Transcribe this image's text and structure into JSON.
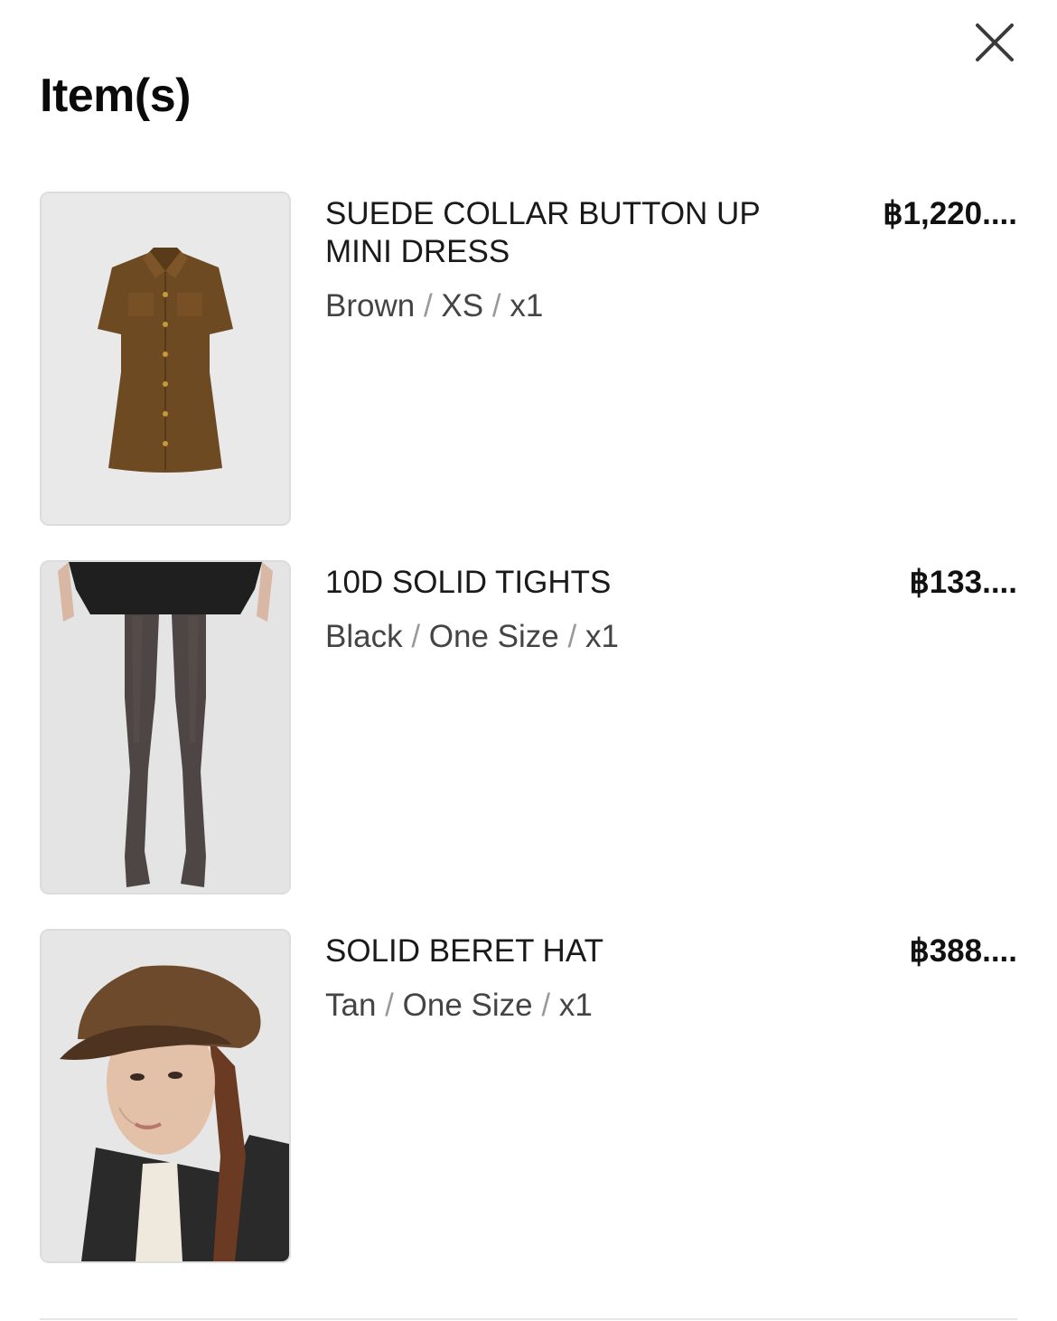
{
  "header": {
    "title": "Item(s)",
    "close_icon": "close-icon"
  },
  "items": [
    {
      "name": "SUEDE COLLAR BUTTON UP MINI DRESS",
      "color": "Brown",
      "size": "XS",
      "quantity": "x1",
      "price": "฿1,220....",
      "image": "brown-mini-dress-photo"
    },
    {
      "name": "10D SOLID TIGHTS",
      "color": "Black",
      "size": "One Size",
      "quantity": "x1",
      "price": "฿133....",
      "image": "black-tights-photo"
    },
    {
      "name": "SOLID BERET HAT",
      "color": "Tan",
      "size": "One Size",
      "quantity": "x1",
      "price": "฿388....",
      "image": "tan-beret-photo"
    }
  ],
  "separator": "/"
}
